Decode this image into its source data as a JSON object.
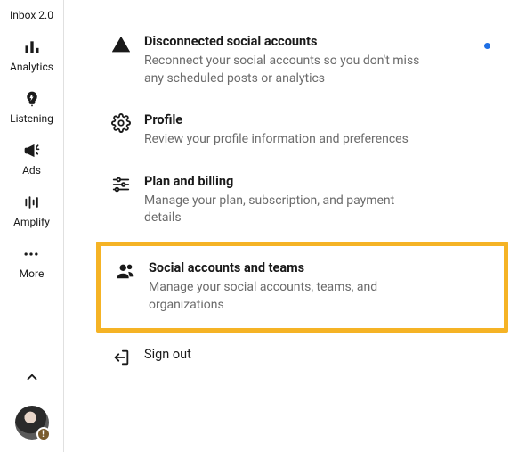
{
  "sidebar": {
    "items": [
      {
        "label": "Inbox 2.0"
      },
      {
        "label": "Analytics"
      },
      {
        "label": "Listening"
      },
      {
        "label": "Ads"
      },
      {
        "label": "Amplify"
      },
      {
        "label": "More"
      }
    ]
  },
  "menu": {
    "disconnected": {
      "title": "Disconnected social accounts",
      "desc": "Reconnect your social accounts so you don't miss any scheduled posts or analytics"
    },
    "profile": {
      "title": "Profile",
      "desc": "Review your profile information and preferences"
    },
    "plan": {
      "title": "Plan and billing",
      "desc": "Manage your plan, subscription, and payment details"
    },
    "social": {
      "title": "Social accounts and teams",
      "desc": "Manage your social accounts, teams, and organizations"
    },
    "signout": {
      "title": "Sign out"
    }
  }
}
